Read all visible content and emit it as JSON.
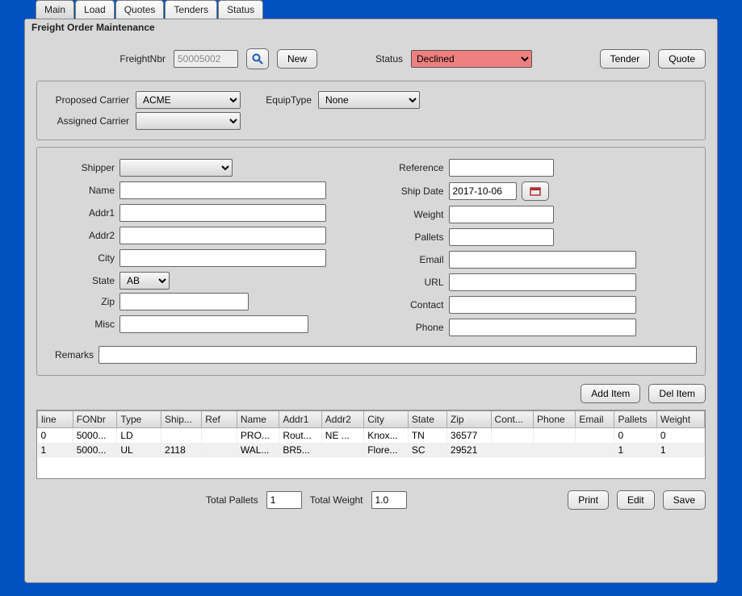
{
  "tabs": [
    "Main",
    "Load",
    "Quotes",
    "Tenders",
    "Status"
  ],
  "activeTab": 0,
  "title": "Freight Order Maintenance",
  "top": {
    "freightNbrLabel": "FreightNbr",
    "freightNbr": "50005002",
    "newLabel": "New",
    "statusLabel": "Status",
    "statusValue": "Declined",
    "tenderLabel": "Tender",
    "quoteLabel": "Quote"
  },
  "carrier": {
    "proposedLabel": "Proposed Carrier",
    "proposedValue": "ACME",
    "equipLabel": "EquipType",
    "equipValue": "None",
    "assignedLabel": "Assigned Carrier",
    "assignedValue": ""
  },
  "ship": {
    "shipperLabel": "Shipper",
    "shipperValue": "",
    "nameLabel": "Name",
    "nameValue": "",
    "addr1Label": "Addr1",
    "addr1Value": "",
    "addr2Label": "Addr2",
    "addr2Value": "",
    "cityLabel": "City",
    "cityValue": "",
    "stateLabel": "State",
    "stateValue": "AB",
    "zipLabel": "Zip",
    "zipValue": "",
    "miscLabel": "Misc",
    "miscValue": "",
    "referenceLabel": "Reference",
    "referenceValue": "",
    "shipDateLabel": "Ship Date",
    "shipDateValue": "2017-10-06",
    "weightLabel": "Weight",
    "weightValue": "",
    "palletsLabel": "Pallets",
    "palletsValue": "",
    "emailLabel": "Email",
    "emailValue": "",
    "urlLabel": "URL",
    "urlValue": "",
    "contactLabel": "Contact",
    "contactValue": "",
    "phoneLabel": "Phone",
    "phoneValue": "",
    "remarksLabel": "Remarks",
    "remarksValue": ""
  },
  "itemBtns": {
    "add": "Add Item",
    "del": "Del Item"
  },
  "table": {
    "headers": [
      "line",
      "FONbr",
      "Type",
      "Ship...",
      "Ref",
      "Name",
      "Addr1",
      "Addr2",
      "City",
      "State",
      "Zip",
      "Cont...",
      "Phone",
      "Email",
      "Pallets",
      "Weight"
    ],
    "rows": [
      [
        "0",
        "5000...",
        "LD",
        "",
        "",
        "PRO...",
        "Rout...",
        "NE ...",
        "Knox...",
        "TN",
        "36577",
        "",
        "",
        "",
        "0",
        "0"
      ],
      [
        "1",
        "5000...",
        "UL",
        "2118",
        "",
        "WAL...",
        "BR5...",
        "",
        "Flore...",
        "SC",
        "29521",
        "",
        "",
        "",
        "1",
        "1"
      ]
    ]
  },
  "bottom": {
    "totalPalletsLabel": "Total Pallets",
    "totalPallets": "1",
    "totalWeightLabel": "Total Weight",
    "totalWeight": "1.0",
    "print": "Print",
    "edit": "Edit",
    "save": "Save"
  }
}
